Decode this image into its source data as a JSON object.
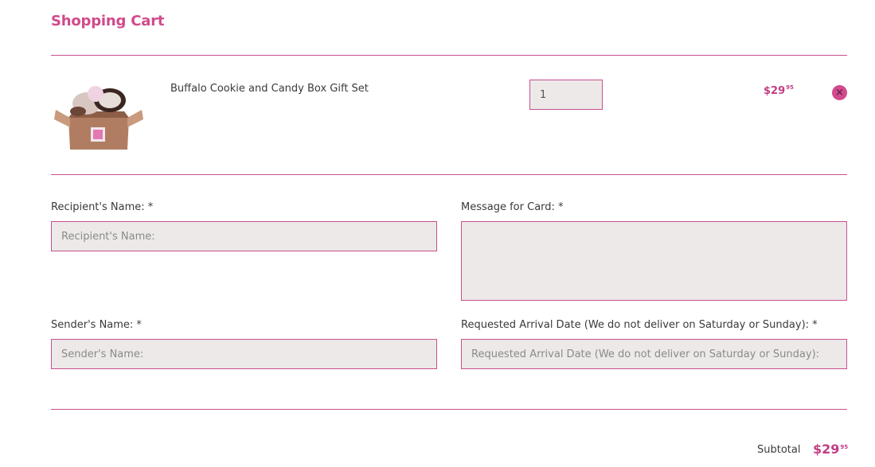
{
  "page": {
    "title": "Shopping Cart"
  },
  "cart": {
    "items": [
      {
        "name": "Buffalo Cookie and Candy Box Gift Set",
        "quantity": "1",
        "price_dollars": "$29",
        "price_cents": "95",
        "remove_icon": "×"
      }
    ]
  },
  "form": {
    "recipient": {
      "label": "Recipient's Name: *",
      "placeholder": "Recipient's Name:",
      "value": ""
    },
    "message": {
      "label": "Message for Card: *",
      "placeholder": "",
      "value": ""
    },
    "sender": {
      "label": "Sender's Name: *",
      "placeholder": "Sender's Name:",
      "value": ""
    },
    "arrival": {
      "label": "Requested Arrival Date (We do not deliver on Saturday or Sunday): *",
      "placeholder": "Requested Arrival Date (We do not deliver on Saturday or Sunday):",
      "value": ""
    }
  },
  "summary": {
    "subtotal_label": "Subtotal",
    "subtotal_dollars": "$29",
    "subtotal_cents": "95"
  },
  "colors": {
    "accent": "#d14a8c",
    "field_bg": "#ece9e8"
  },
  "icons": {
    "remove": "close-icon",
    "product": "gift-box-image"
  }
}
